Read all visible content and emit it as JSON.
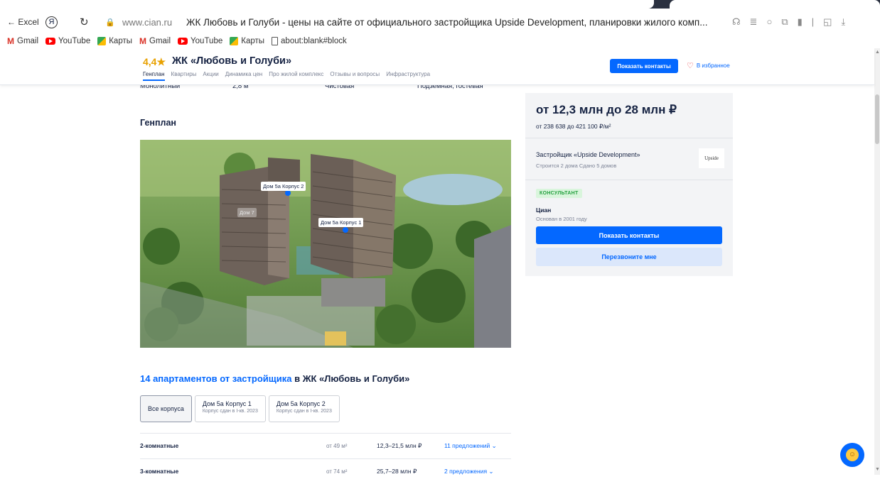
{
  "browser": {
    "back_label": "← Excel",
    "domain": "www.cian.ru",
    "page_title": "ЖК Любовь и Голуби - цены на сайте от официального застройщика Upside Development, планировки жилого комп...",
    "bookmarks": [
      {
        "label": "Gmail",
        "icon": "gmail-icon"
      },
      {
        "label": "YouTube",
        "icon": "youtube-icon"
      },
      {
        "label": "Карты",
        "icon": "maps-icon"
      },
      {
        "label": "Gmail",
        "icon": "gmail-icon"
      },
      {
        "label": "YouTube",
        "icon": "youtube-icon"
      },
      {
        "label": "Карты",
        "icon": "maps-icon"
      },
      {
        "label": "about:blank#block",
        "icon": "doc-icon"
      }
    ]
  },
  "header": {
    "rating": "4,4",
    "title": "ЖК «Любовь и Голуби»",
    "tabs": [
      "Генплан",
      "Квартиры",
      "Акции",
      "Динамика цен",
      "Про жилой комплекс",
      "Отзывы и вопросы",
      "Инфраструктура"
    ],
    "contacts_button": "Показать контакты",
    "favorites": "В избранное"
  },
  "specs": [
    "Монолитный",
    "2,8 м",
    "Чистовая",
    "Подземная, гостевая"
  ],
  "genplan": {
    "title": "Генплан",
    "labels": [
      "Дом 5а Корпус 2",
      "Дом 7",
      "Дом 5а Корпус 1"
    ]
  },
  "price_card": {
    "price": "от 12,3 млн до 28 млн ₽",
    "price_per_m2": "от 238 638 до 421 100 ₽/м²",
    "developer": "Застройщик «Upside Development»",
    "developer_stats": "Строится 2 дома    Сдано 5 домов",
    "developer_logo": "Upside",
    "badge": "КОНСУЛЬТАНТ",
    "agent": "Циан",
    "agent_since": "Основан в 2001 году",
    "contacts_button": "Показать контакты",
    "callback_button": "Перезвоните мне"
  },
  "apartments": {
    "heading_link": "14 апартаментов от застройщика",
    "heading_rest": " в ЖК «Любовь и Голуби»",
    "filters": [
      {
        "title": "Все корпуса",
        "sub": ""
      },
      {
        "title": "Дом 5а Корпус 1",
        "sub": "Корпус сдан в I-кв. 2023"
      },
      {
        "title": "Дом 5а Корпус 2",
        "sub": "Корпус сдан в I-кв. 2023"
      }
    ],
    "rows": [
      {
        "rooms": "2-комнатные",
        "area": "от 49 м²",
        "price": "12,3–21,5 млн ₽",
        "offers": "11 предложений ⌄"
      },
      {
        "rooms": "3-комнатные",
        "area": "от 74 м²",
        "price": "25,7–28 млн ₽",
        "offers": "2 предложения ⌄"
      }
    ]
  }
}
